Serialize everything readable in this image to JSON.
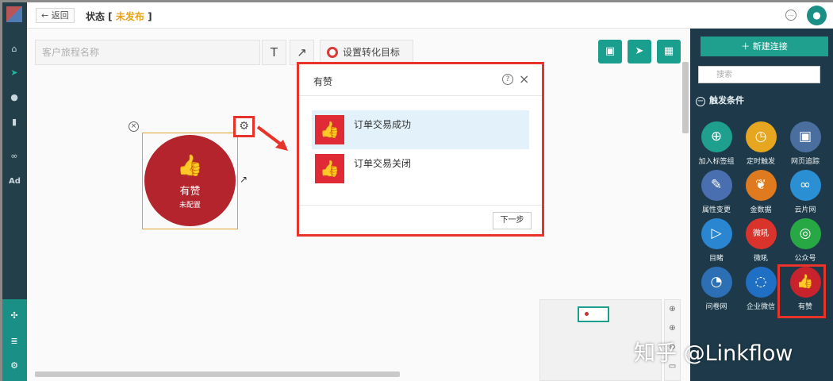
{
  "header": {
    "back_label": "← 返回",
    "status_prefix": "状态 [",
    "status_value": "未发布",
    "status_suffix": "]"
  },
  "left_nav": {
    "items": [
      "home-icon",
      "send-icon",
      "user-icon",
      "chart-icon",
      "wechat-icon",
      "ad-icon"
    ],
    "ad_label": "Ad",
    "bottom_items": [
      "share-icon",
      "list-icon",
      "gear-icon"
    ]
  },
  "toolbar": {
    "name_placeholder": "客户旅程名称",
    "text_tool": "T",
    "arrow_tool": "↗",
    "goal_label": "设置转化目标"
  },
  "canvas_node": {
    "close": "×",
    "name": "有赞",
    "status": "未配置",
    "thumb": "👍",
    "gear": "⚙",
    "link": "↗"
  },
  "dialog": {
    "title": "有赞",
    "help": "?",
    "close": "×",
    "options": [
      {
        "label": "订单交易成功",
        "selected": true
      },
      {
        "label": "订单交易关闭",
        "selected": false
      }
    ],
    "next_label": "下一步"
  },
  "right_panel": {
    "new_connection": "＋ 新建连接",
    "search_placeholder": "搜索",
    "section": "触发条件",
    "tiles": [
      {
        "label": "加入标签组",
        "color": "#1fa08e",
        "icon": "user-plus-icon",
        "glyph": "⊕"
      },
      {
        "label": "定时触发",
        "color": "#e6a620",
        "icon": "clock-icon",
        "glyph": "◷"
      },
      {
        "label": "网页追踪",
        "color": "#4a6f9e",
        "icon": "web-icon",
        "glyph": "▣"
      },
      {
        "label": "属性变更",
        "color": "#4a6fb0",
        "icon": "edit-icon",
        "glyph": "✎"
      },
      {
        "label": "金数据",
        "color": "#e07a1f",
        "icon": "plant-icon",
        "glyph": "❦"
      },
      {
        "label": "云片网",
        "color": "#2a8fd3",
        "icon": "cloud-icon",
        "glyph": "∞"
      },
      {
        "label": "目睹",
        "color": "#2a86d0",
        "icon": "play-icon",
        "glyph": "▷"
      },
      {
        "label": "微吼",
        "color": "#d9332b",
        "icon": "weihou-icon",
        "glyph": "微吼"
      },
      {
        "label": "公众号",
        "color": "#28a745",
        "icon": "wechat-icon",
        "glyph": "◎"
      },
      {
        "label": "问卷网",
        "color": "#2d6fb5",
        "icon": "survey-icon",
        "glyph": "◔"
      },
      {
        "label": "企业微信",
        "color": "#1f6fc4",
        "icon": "enterprise-wechat-icon",
        "glyph": "◌"
      },
      {
        "label": "有赞",
        "color": "#c8232d",
        "icon": "thumb-icon",
        "glyph": "👍"
      }
    ]
  },
  "zoom": [
    "⊕",
    "⊕",
    "⊖",
    "▭"
  ],
  "watermark": "知乎 @Linkflow"
}
